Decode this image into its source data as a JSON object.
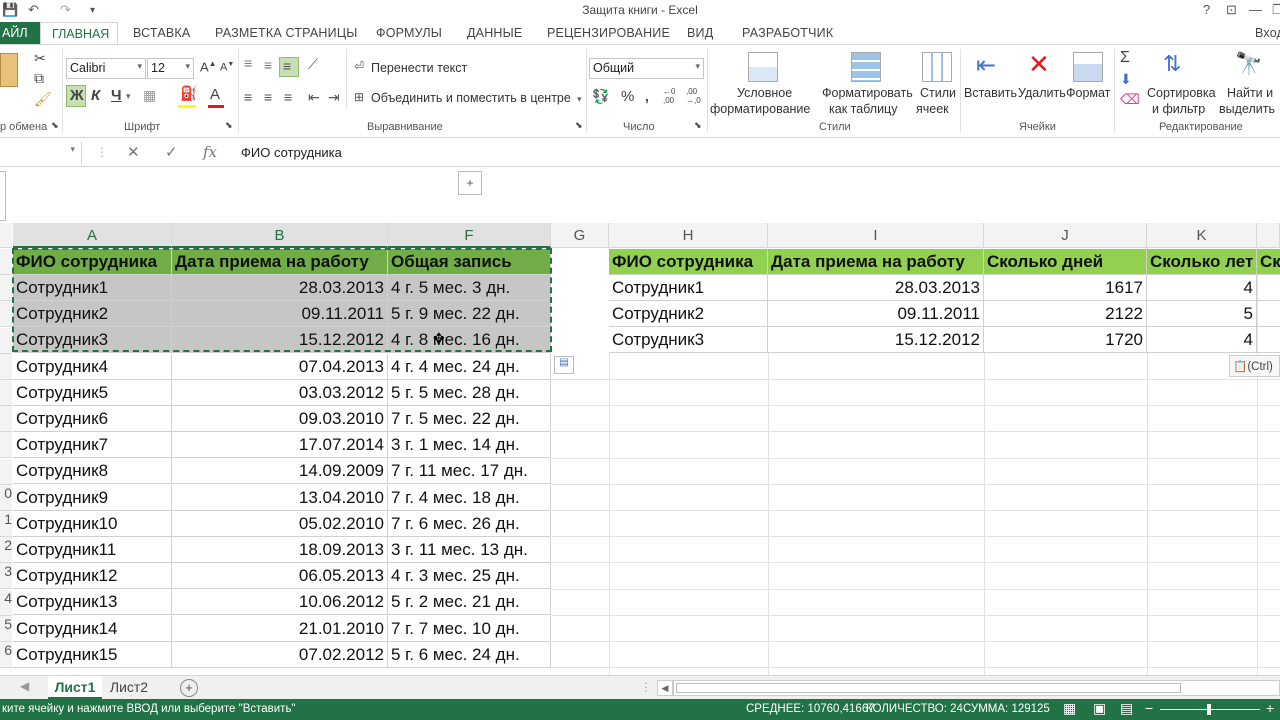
{
  "window": {
    "title": "Защита книги - Excel",
    "help": "?",
    "minimize": "—",
    "restore": "❐",
    "close": "✕",
    "user": "Вход"
  },
  "tabs": {
    "file": "АЙЛ",
    "items": [
      "ГЛАВНАЯ",
      "ВСТАВКА",
      "РАЗМЕТКА СТРАНИЦЫ",
      "ФОРМУЛЫ",
      "ДАННЫЕ",
      "РЕЦЕНЗИРОВАНИЕ",
      "ВИД",
      "РАЗРАБОТЧИК"
    ]
  },
  "ribbon": {
    "clipboard_label": "р обмена",
    "font_name": "Calibri",
    "font_size": "12",
    "font_label": "Шрифт",
    "bold": "Ж",
    "italic": "К",
    "underline": "Ч",
    "wrap_text": "Перенести текст",
    "merge_center": "Объединить и поместить в центре",
    "alignment_label": "Выравнивание",
    "number_format": "Общий",
    "number_label": "Число",
    "cond_format_1": "Условное",
    "cond_format_2": "форматирование",
    "format_table_1": "Форматировать",
    "format_table_2": "как таблицу",
    "cell_styles_1": "Стили",
    "cell_styles_2": "ячеек",
    "styles_label": "Стили",
    "insert": "Вставить",
    "delete": "Удалить",
    "format": "Формат",
    "cells_label": "Ячейки",
    "sort_filter_1": "Сортировка",
    "sort_filter_2": "и фильтр",
    "find_select_1": "Найти и",
    "find_select_2": "выделить",
    "editing_label": "Редактирование"
  },
  "formula_bar": {
    "content": "ФИО сотрудника",
    "fx": "fx"
  },
  "columns_left": [
    "A",
    "B",
    "F",
    "G"
  ],
  "columns_right": [
    "H",
    "I",
    "J",
    "K"
  ],
  "table_left": {
    "headers": [
      "ФИО сотрудника",
      "Дата приема на работу",
      "Общая запись"
    ],
    "rows": [
      [
        "Сотрудник1",
        "28.03.2013",
        "4 г. 5 мес. 3 дн."
      ],
      [
        "Сотрудник2",
        "09.11.2011",
        "5 г. 9 мес. 22 дн."
      ],
      [
        "Сотрудник3",
        "15.12.2012",
        "4 г. 8 мес. 16 дн."
      ],
      [
        "Сотрудник4",
        "07.04.2013",
        "4 г. 4 мес. 24 дн."
      ],
      [
        "Сотрудник5",
        "03.03.2012",
        "5 г. 5 мес. 28 дн."
      ],
      [
        "Сотрудник6",
        "09.03.2010",
        "7 г. 5 мес. 22 дн."
      ],
      [
        "Сотрудник7",
        "17.07.2014",
        "3 г. 1 мес. 14 дн."
      ],
      [
        "Сотрудник8",
        "14.09.2009",
        "7 г. 11 мес. 17 дн."
      ],
      [
        "Сотрудник9",
        "13.04.2010",
        "7 г. 4 мес. 18 дн."
      ],
      [
        "Сотрудник10",
        "05.02.2010",
        "7 г. 6 мес. 26 дн."
      ],
      [
        "Сотрудник11",
        "18.09.2013",
        "3 г. 11 мес. 13 дн."
      ],
      [
        "Сотрудник12",
        "06.05.2013",
        "4 г. 3 мес. 25 дн."
      ],
      [
        "Сотрудник13",
        "10.06.2012",
        "5 г. 2 мес. 21 дн."
      ],
      [
        "Сотрудник14",
        "21.01.2010",
        "7 г. 7 мес. 10 дн."
      ],
      [
        "Сотрудник15",
        "07.02.2012",
        "5 г. 6 мес. 24 дн."
      ]
    ]
  },
  "row_numbers": [
    "",
    "",
    "",
    "",
    "",
    "",
    "",
    "",
    "0",
    "1",
    "2",
    "3",
    "4",
    "5",
    "6"
  ],
  "table_right": {
    "headers": [
      "ФИО сотрудника",
      "Дата приема на работу",
      "Сколько дней",
      "Сколько лет",
      "Ск"
    ],
    "rows": [
      [
        "Сотрудник1",
        "28.03.2013",
        "1617",
        "4"
      ],
      [
        "Сотрудник2",
        "09.11.2011",
        "2122",
        "5"
      ],
      [
        "Сотрудник3",
        "15.12.2012",
        "1720",
        "4"
      ]
    ]
  },
  "paste_tag": "(Ctrl)",
  "sheets": {
    "active": "Лист1",
    "other": "Лист2"
  },
  "status": {
    "message": "ките ячейку и нажмите ВВОД или выберите \"Вставить\"",
    "average": "СРЕДНЕЕ: 10760,41667",
    "count": "КОЛИЧЕСТВО: 24",
    "sum": "СУММА: 129125"
  }
}
